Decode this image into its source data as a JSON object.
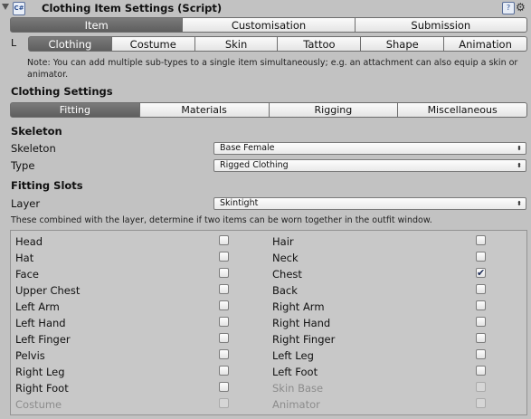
{
  "header": {
    "title": "Clothing Item Settings (Script)",
    "script_icon_glyph": "C#",
    "help_glyph": "?",
    "gear_glyph": "⚙"
  },
  "tabs_main": [
    {
      "label": "Item",
      "active": true
    },
    {
      "label": "Customisation",
      "active": false
    },
    {
      "label": "Submission",
      "active": false
    }
  ],
  "tabs_sub_marker": "L",
  "tabs_sub": [
    {
      "label": "Clothing",
      "active": true
    },
    {
      "label": "Costume",
      "active": false
    },
    {
      "label": "Skin",
      "active": false
    },
    {
      "label": "Tattoo",
      "active": false
    },
    {
      "label": "Shape",
      "active": false
    },
    {
      "label": "Animation",
      "active": false
    }
  ],
  "note": "Note: You can add multiple sub-types to a single item simultaneously; e.g. an attachment can also equip a skin or animator.",
  "clothing_settings_title": "Clothing Settings",
  "tabs_settings": [
    {
      "label": "Fitting",
      "active": true
    },
    {
      "label": "Materials",
      "active": false
    },
    {
      "label": "Rigging",
      "active": false
    },
    {
      "label": "Miscellaneous",
      "active": false
    }
  ],
  "skeleton_section": {
    "title": "Skeleton",
    "skeleton_label": "Skeleton",
    "skeleton_value": "Base Female",
    "type_label": "Type",
    "type_value": "Rigged Clothing"
  },
  "fitting_section": {
    "title": "Fitting Slots",
    "layer_label": "Layer",
    "layer_value": "Skintight",
    "hint": "These combined with the layer, determine if two items can be worn together in the outfit window."
  },
  "dropdown_arrow": "⬍",
  "check_glyph": "✔",
  "slots": [
    {
      "left": {
        "label": "Head",
        "checked": false,
        "disabled": false
      },
      "right": {
        "label": "Hair",
        "checked": false,
        "disabled": false
      }
    },
    {
      "left": {
        "label": "Hat",
        "checked": false,
        "disabled": false
      },
      "right": {
        "label": "Neck",
        "checked": false,
        "disabled": false
      }
    },
    {
      "left": {
        "label": "Face",
        "checked": false,
        "disabled": false
      },
      "right": {
        "label": "Chest",
        "checked": true,
        "disabled": false
      }
    },
    {
      "left": {
        "label": "Upper Chest",
        "checked": false,
        "disabled": false
      },
      "right": {
        "label": "Back",
        "checked": false,
        "disabled": false
      }
    },
    {
      "left": {
        "label": "Left Arm",
        "checked": false,
        "disabled": false
      },
      "right": {
        "label": "Right Arm",
        "checked": false,
        "disabled": false
      }
    },
    {
      "left": {
        "label": "Left Hand",
        "checked": false,
        "disabled": false
      },
      "right": {
        "label": "Right Hand",
        "checked": false,
        "disabled": false
      }
    },
    {
      "left": {
        "label": "Left Finger",
        "checked": false,
        "disabled": false
      },
      "right": {
        "label": "Right Finger",
        "checked": false,
        "disabled": false
      }
    },
    {
      "left": {
        "label": "Pelvis",
        "checked": false,
        "disabled": false
      },
      "right": {
        "label": "Left Leg",
        "checked": false,
        "disabled": false
      }
    },
    {
      "left": {
        "label": "Right Leg",
        "checked": false,
        "disabled": false
      },
      "right": {
        "label": "Left Foot",
        "checked": false,
        "disabled": false
      }
    },
    {
      "left": {
        "label": "Right Foot",
        "checked": false,
        "disabled": false
      },
      "right": {
        "label": "Skin Base",
        "checked": false,
        "disabled": true
      }
    },
    {
      "left": {
        "label": "Costume",
        "checked": false,
        "disabled": true
      },
      "right": {
        "label": "Animator",
        "checked": false,
        "disabled": true
      }
    }
  ]
}
